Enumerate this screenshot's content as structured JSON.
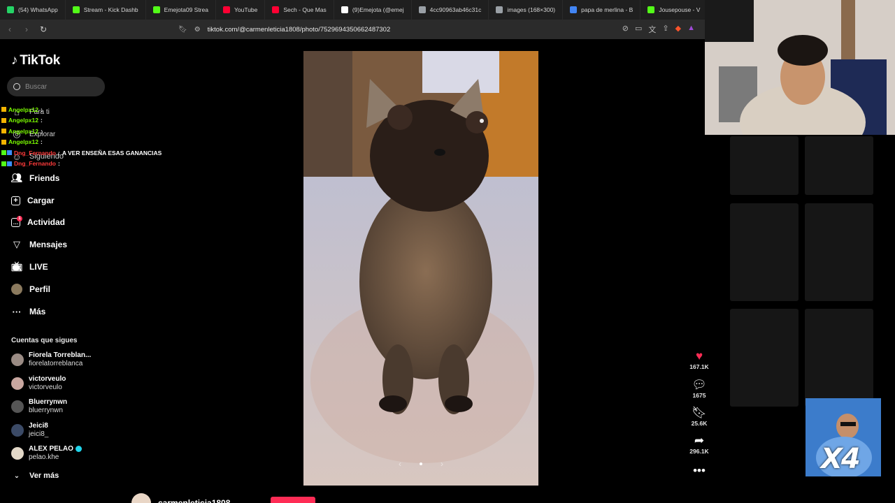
{
  "browser": {
    "tabs": [
      {
        "label": "(54) WhatsApp",
        "color": "#25d366"
      },
      {
        "label": "Stream - Kick Dashb",
        "color": "#53fc18"
      },
      {
        "label": "Emejota09 Strea",
        "color": "#53fc18"
      },
      {
        "label": "YouTube",
        "color": "#ff0033"
      },
      {
        "label": "Sech - Que Mas",
        "color": "#ff0033"
      },
      {
        "label": "(9)Emejota (@emej",
        "color": "#ffffff"
      },
      {
        "label": "4cc90963ab46c31c",
        "color": "#9aa0a6"
      },
      {
        "label": "images (168×300)",
        "color": "#9aa0a6"
      },
      {
        "label": "papa de merlina - B",
        "color": "#4285f4"
      },
      {
        "label": "Jousepouse - V",
        "color": "#53fc18"
      }
    ],
    "url": "tiktok.com/@carmenleticia1808/photo/7529694350662487302"
  },
  "sidebar": {
    "logo": "TikTok",
    "search_placeholder": "Buscar",
    "nav": {
      "para_ti": "Para ti",
      "explorar": "Explorar",
      "siguiendo": "Siguiendo",
      "friends": "Friends",
      "cargar": "Cargar",
      "actividad": "Actividad",
      "mensajes": "Mensajes",
      "live": "LIVE",
      "perfil": "Perfil",
      "mas": "Más"
    },
    "activity_badge": "1",
    "following_title": "Cuentas que sigues",
    "accounts": [
      {
        "name": "Fiorela Torreblan...",
        "handle": "fiorelatorreblanca",
        "verified": false
      },
      {
        "name": "victorveulo",
        "handle": "victorveulo",
        "verified": false
      },
      {
        "name": "Bluerrynwn",
        "handle": "bluerrynwn",
        "verified": false
      },
      {
        "name": "Jeici8",
        "handle": "jeici8_",
        "verified": false
      },
      {
        "name": "ALEX PELAO",
        "handle": "pelao.khe",
        "verified": true
      }
    ],
    "see_more": "Ver más"
  },
  "chat": [
    {
      "user": "Angelpx12",
      "sep": ":",
      "message": "",
      "color": "#7cfc00"
    },
    {
      "user": "Angelpx12",
      "sep": ":",
      "message": "",
      "color": "#7cfc00"
    },
    {
      "user": "Angelpx12",
      "sep": ":",
      "message": "",
      "color": "#7cfc00"
    },
    {
      "user": "Angelpx12",
      "sep": ":",
      "message": "",
      "color": "#7cfc00"
    },
    {
      "user": "Dng_Fernando",
      "sep": ":",
      "message": "A VER ENSEÑA ESAS GANANCIAS",
      "color": "#ff3b3b"
    },
    {
      "user": "Dng_Fernando",
      "sep": ":",
      "message": "",
      "color": "#ff3b3b"
    }
  ],
  "post": {
    "author": "carmenleticia1808",
    "likes": "167.1K",
    "comments": "1675",
    "saves": "25.6K",
    "shares": "296.1K"
  },
  "overlay": {
    "multiplier": "X4"
  }
}
